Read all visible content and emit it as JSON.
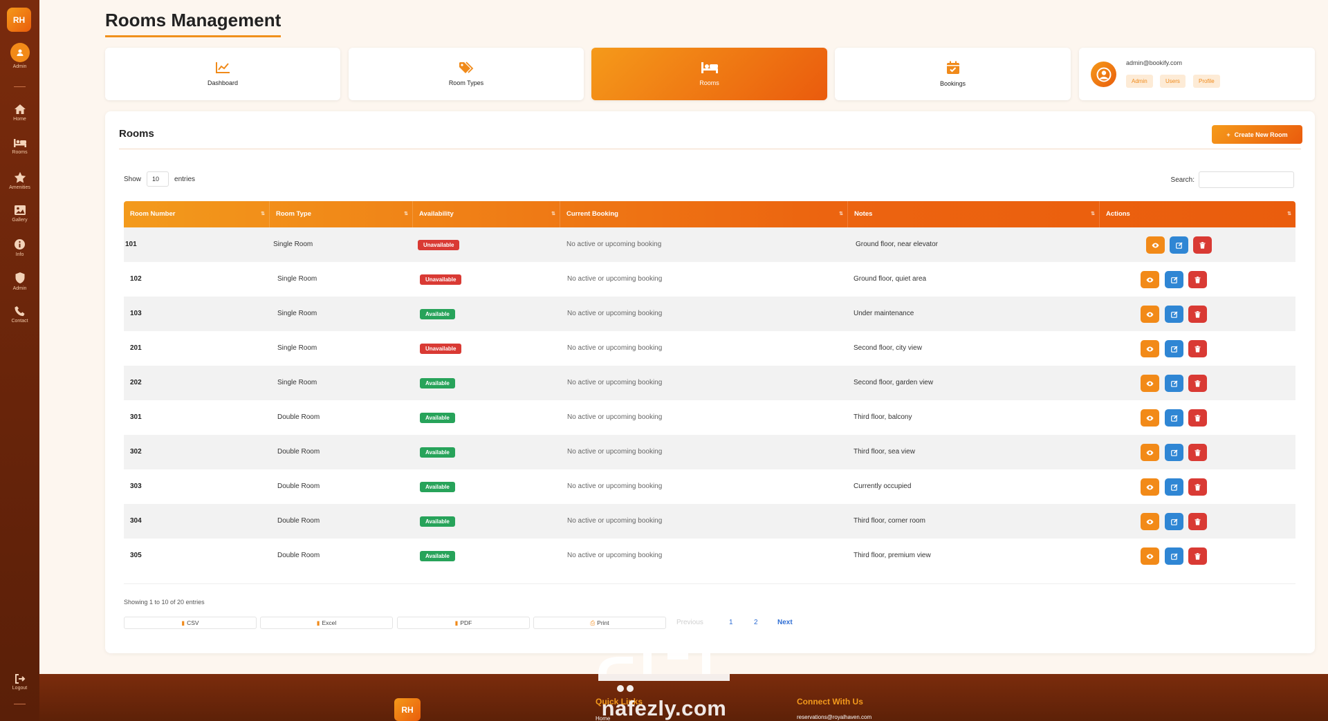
{
  "sidebar": {
    "logo": "RH",
    "admin_label": "Admin",
    "items": [
      {
        "label": "Home",
        "icon": "home-icon"
      },
      {
        "label": "Rooms",
        "icon": "bed-icon"
      },
      {
        "label": "Amenities",
        "icon": "star-icon"
      },
      {
        "label": "Gallery",
        "icon": "image-icon"
      },
      {
        "label": "Info",
        "icon": "info-icon"
      },
      {
        "label": "Admin",
        "icon": "shield-icon"
      },
      {
        "label": "Contact",
        "icon": "phone-icon"
      }
    ],
    "logout_label": "Logout"
  },
  "page_title": "Rooms Management",
  "nav_cards": [
    {
      "label": "Dashboard",
      "icon": "chart-line-icon",
      "active": false
    },
    {
      "label": "Room Types",
      "icon": "tags-icon",
      "active": false
    },
    {
      "label": "Rooms",
      "icon": "bed-icon",
      "active": true
    },
    {
      "label": "Bookings",
      "icon": "calendar-check-icon",
      "active": false
    }
  ],
  "profile": {
    "email": "admin@bookify.com",
    "tags": [
      "Admin",
      "Users",
      "Profile"
    ]
  },
  "rooms_panel": {
    "title": "Rooms",
    "create_button": "Create New Room",
    "show_label": "Show",
    "entries_value": "10",
    "entries_label": "entries",
    "search_label": "Search:",
    "search_value": ""
  },
  "table": {
    "headers": [
      "Room Number",
      "Room Type",
      "Availability",
      "Current Booking",
      "Notes",
      "Actions"
    ],
    "rows": [
      {
        "number": "101",
        "type": "Single Room",
        "availability": "Unavailable",
        "booking": "No active or upcoming booking",
        "notes": "Ground floor, near elevator"
      },
      {
        "number": "102",
        "type": "Single Room",
        "availability": "Unavailable",
        "booking": "No active or upcoming booking",
        "notes": "Ground floor, quiet area"
      },
      {
        "number": "103",
        "type": "Single Room",
        "availability": "Available",
        "booking": "No active or upcoming booking",
        "notes": "Under maintenance"
      },
      {
        "number": "201",
        "type": "Single Room",
        "availability": "Unavailable",
        "booking": "No active or upcoming booking",
        "notes": "Second floor, city view"
      },
      {
        "number": "202",
        "type": "Single Room",
        "availability": "Available",
        "booking": "No active or upcoming booking",
        "notes": "Second floor, garden view"
      },
      {
        "number": "301",
        "type": "Double Room",
        "availability": "Available",
        "booking": "No active or upcoming booking",
        "notes": "Third floor, balcony"
      },
      {
        "number": "302",
        "type": "Double Room",
        "availability": "Available",
        "booking": "No active or upcoming booking",
        "notes": "Third floor, sea view"
      },
      {
        "number": "303",
        "type": "Double Room",
        "availability": "Available",
        "booking": "No active or upcoming booking",
        "notes": "Currently occupied"
      },
      {
        "number": "304",
        "type": "Double Room",
        "availability": "Available",
        "booking": "No active or upcoming booking",
        "notes": "Third floor, corner room"
      },
      {
        "number": "305",
        "type": "Double Room",
        "availability": "Available",
        "booking": "No active or upcoming booking",
        "notes": "Third floor, premium view"
      }
    ]
  },
  "table_footer": {
    "showing": "Showing 1 to 10 of 20 entries",
    "exports": [
      "CSV",
      "Excel",
      "PDF",
      "Print"
    ],
    "pagination": {
      "previous": "Previous",
      "pages": [
        "1",
        "2"
      ],
      "next": "Next"
    }
  },
  "footer": {
    "logo": "RH",
    "quick_links_title": "Quick Links",
    "quick_links": [
      "Home"
    ],
    "connect_title": "Connect With Us",
    "email": "reservations@royalhaven.com"
  },
  "watermark": {
    "text": "nafezly.com"
  },
  "colors": {
    "accent_orange": "#f28a18",
    "accent_deep": "#ea5b0d",
    "sidebar_brown": "#6a250b",
    "available_green": "#27a35a",
    "unavailable_red": "#d93a34",
    "edit_blue": "#2f86d4"
  }
}
